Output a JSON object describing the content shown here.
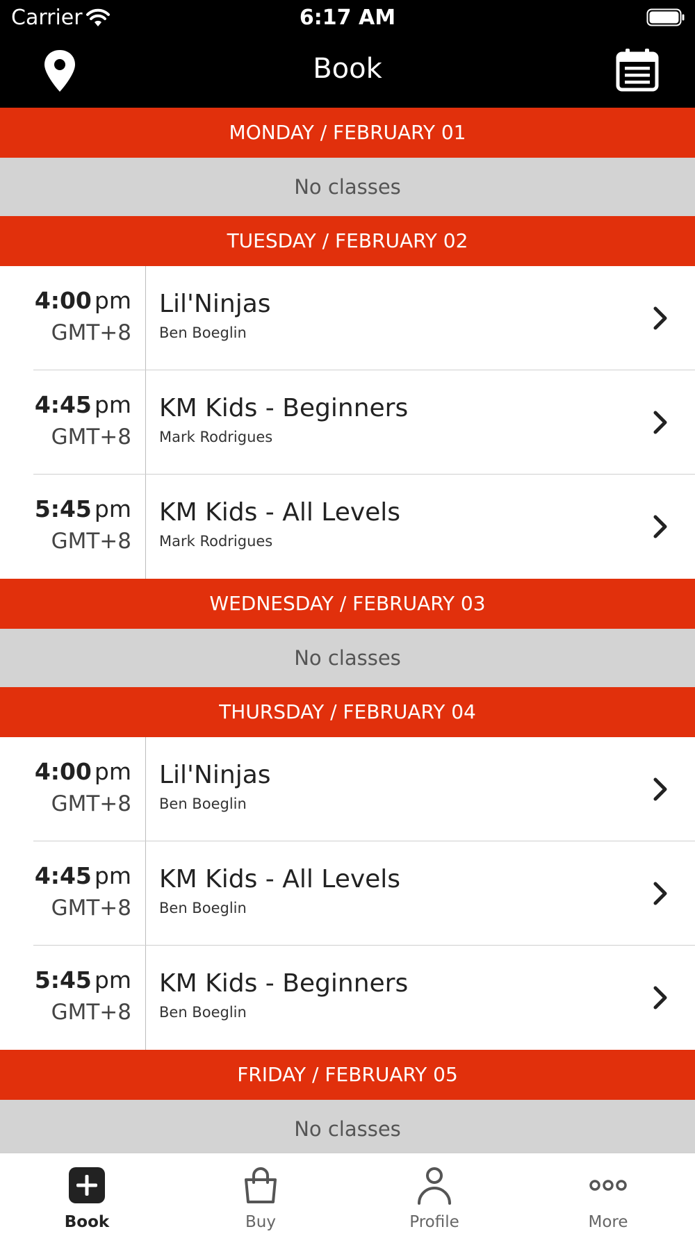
{
  "status_bar": {
    "carrier": "Carrier",
    "time": "6:17 AM"
  },
  "nav": {
    "title": "Book",
    "left_icon": "location-pin-icon",
    "right_icon": "calendar-list-icon"
  },
  "colors": {
    "accent": "#e1300c",
    "nav_background": "#000000",
    "no_classes_background": "#d3d3d3"
  },
  "days": [
    {
      "header": "MONDAY / FEBRUARY 01",
      "no_classes": "No classes",
      "classes": []
    },
    {
      "header": "TUESDAY / FEBRUARY 02",
      "classes": [
        {
          "time": "4:00",
          "ampm": "pm",
          "tz": "GMT+8",
          "name": "Lil'Ninjas",
          "instructor": "Ben Boeglin"
        },
        {
          "time": "4:45",
          "ampm": "pm",
          "tz": "GMT+8",
          "name": "KM Kids - Beginners",
          "instructor": "Mark Rodrigues"
        },
        {
          "time": "5:45",
          "ampm": "pm",
          "tz": "GMT+8",
          "name": "KM Kids - All Levels",
          "instructor": "Mark Rodrigues"
        }
      ]
    },
    {
      "header": "WEDNESDAY / FEBRUARY 03",
      "no_classes": "No classes",
      "classes": []
    },
    {
      "header": "THURSDAY / FEBRUARY 04",
      "classes": [
        {
          "time": "4:00",
          "ampm": "pm",
          "tz": "GMT+8",
          "name": "Lil'Ninjas",
          "instructor": "Ben Boeglin"
        },
        {
          "time": "4:45",
          "ampm": "pm",
          "tz": "GMT+8",
          "name": "KM Kids - All Levels",
          "instructor": "Ben Boeglin"
        },
        {
          "time": "5:45",
          "ampm": "pm",
          "tz": "GMT+8",
          "name": "KM Kids - Beginners",
          "instructor": "Ben Boeglin"
        }
      ]
    },
    {
      "header": "FRIDAY / FEBRUARY 05",
      "no_classes": "No classes",
      "classes": []
    }
  ],
  "tabs": [
    {
      "label": "Book",
      "icon": "plus-square-icon",
      "active": true
    },
    {
      "label": "Buy",
      "icon": "shopping-bag-icon",
      "active": false
    },
    {
      "label": "Profile",
      "icon": "person-icon",
      "active": false
    },
    {
      "label": "More",
      "icon": "ellipsis-icon",
      "active": false
    }
  ]
}
